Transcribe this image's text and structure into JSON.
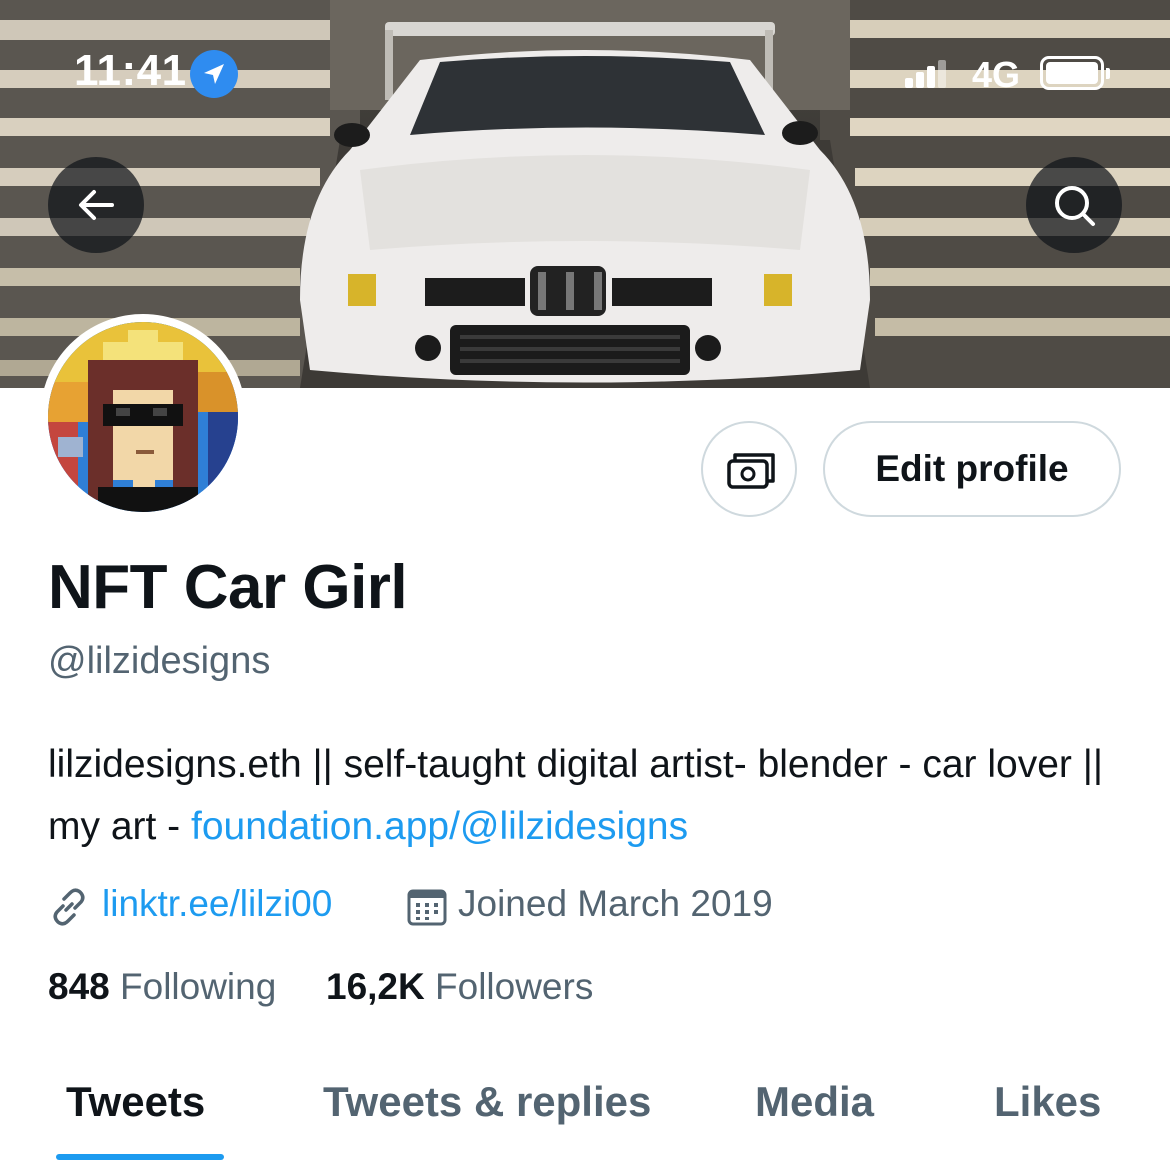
{
  "status_bar": {
    "time": "11:41",
    "network": "4G",
    "icons": [
      "location-arrow-icon",
      "signal-bars-icon",
      "battery-icon"
    ]
  },
  "header": {
    "icons": [
      "back-arrow-icon",
      "search-icon"
    ]
  },
  "profile": {
    "display_name": "NFT Car Girl",
    "handle": "@lilzidesigns",
    "bio_text": "lilzidesigns.eth || self-taught digital artist- blender - car lover || my art - ",
    "bio_link": "foundation.app/@lilzidesigns",
    "website": "linktr.ee/lilzi00",
    "joined": "Joined March 2019",
    "following_count": "848",
    "following_label": "Following",
    "followers_count": "16,2K",
    "followers_label": "Followers"
  },
  "actions": {
    "tip_icon": "money-icon",
    "edit_profile_label": "Edit profile"
  },
  "tabs": [
    {
      "label": "Tweets",
      "active": true
    },
    {
      "label": "Tweets & replies",
      "active": false
    },
    {
      "label": "Media",
      "active": false
    },
    {
      "label": "Likes",
      "active": false
    }
  ],
  "colors": {
    "accent": "#1d9bf0",
    "text_primary": "#0f1419",
    "text_secondary": "#536471",
    "border": "#cfd9de"
  }
}
